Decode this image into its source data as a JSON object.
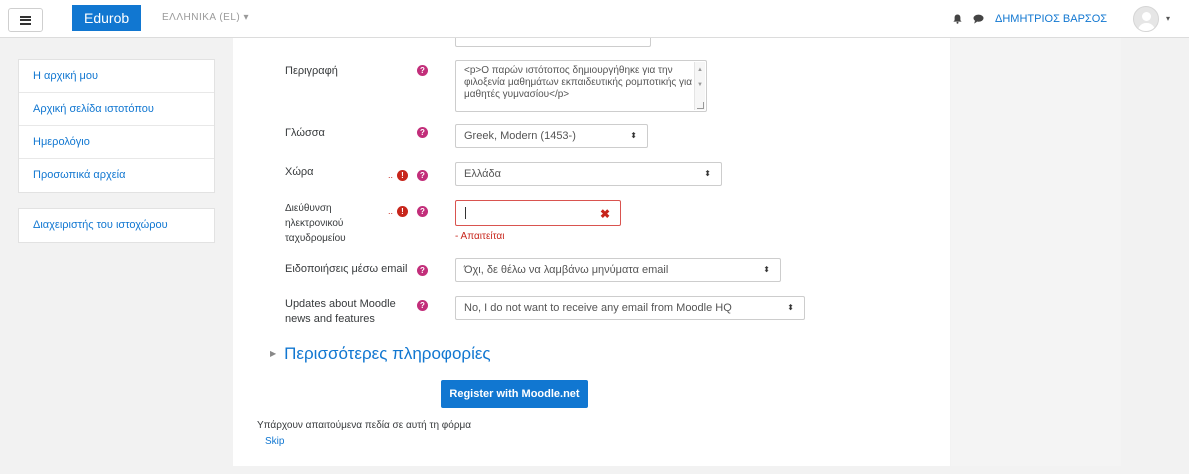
{
  "navbar": {
    "brand": "Edurob",
    "language": "ΕΛΛΗΝΙΚΑ (EL)",
    "language_caret": "▾",
    "username": "ΔΗΜΗΤΡΙΟΣ ΒΑΡΣΟΣ",
    "user_caret": "▾"
  },
  "sidebar": {
    "nav_items": [
      {
        "label": "Η αρχική μου"
      },
      {
        "label": "Αρχική σελίδα ιστοτόπου"
      },
      {
        "label": "Ημερολόγιο"
      },
      {
        "label": "Προσωπικά αρχεία"
      }
    ],
    "admin_items": [
      {
        "label": "Διαχειριστής του ιστοχώρου"
      }
    ]
  },
  "form": {
    "description": {
      "label": "Περιγραφή",
      "value": "<p>Ο παρών ιστότοπος δημιουργήθηκε για την φιλοξενία μαθημάτων εκπαιδευτικής ρομποτικής για μαθητές γυμνασίου</p>"
    },
    "language": {
      "label": "Γλώσσα",
      "value": "Greek, Modern (1453-)"
    },
    "country": {
      "label": "Χώρα",
      "value": "Ελλάδα"
    },
    "email": {
      "label_line1": "Διεύθυνση",
      "label_line2": "ηλεκτρονικού",
      "label_line3": "ταχυδρομείου",
      "value": "",
      "error": "- Απαιτείται"
    },
    "email_notifications": {
      "label": "Ειδοποιήσεις μέσω email",
      "value": "Όχι, δε θέλω να λαμβάνω μηνύματα email"
    },
    "updates": {
      "label_line1": "Updates about Moodle",
      "label_line2": "news and features",
      "value": "No, I do not want to receive any email from Moodle HQ"
    },
    "more_info": "Περισσότερες πληροφορίες",
    "register_button": "Register with Moodle.net",
    "required_note": "Υπάρχουν απαιτούμενα πεδία σε αυτή τη φόρμα",
    "skip": "Skip"
  },
  "icons": {
    "help_glyph": "?",
    "required_glyph": "!",
    "clear_glyph": "✖",
    "select_arrow": "⬍"
  },
  "colors": {
    "brand": "#1177d1",
    "help": "#c22e7a",
    "error": "#c7251b"
  }
}
